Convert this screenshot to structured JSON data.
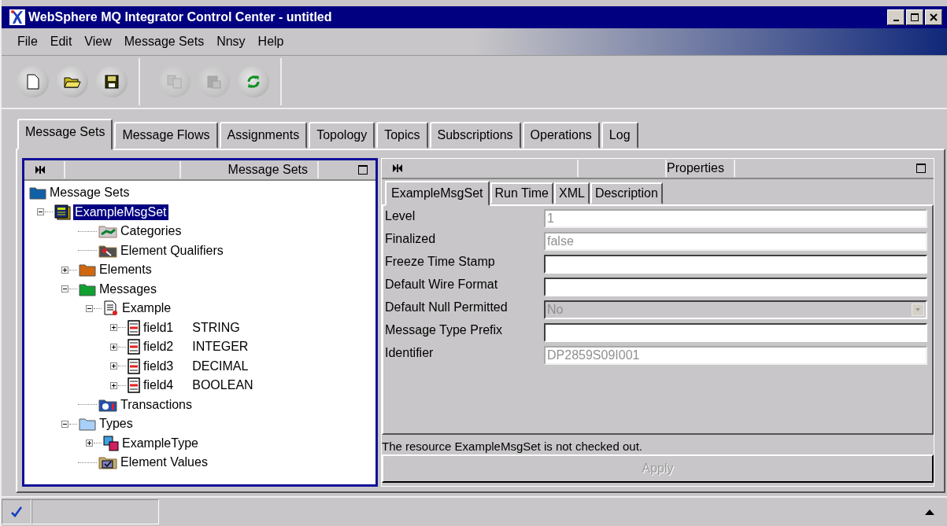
{
  "window": {
    "title": "WebSphere MQ Integrator Control Center - untitled"
  },
  "menu": [
    "File",
    "Edit",
    "View",
    "Message Sets",
    "Nnsy",
    "Help"
  ],
  "toolbar": [
    [
      {
        "kind": "new",
        "disabled": false
      },
      {
        "kind": "open",
        "disabled": false
      },
      {
        "kind": "save",
        "disabled": false
      }
    ],
    [
      {
        "kind": "copy",
        "disabled": true
      },
      {
        "kind": "paste",
        "disabled": true
      },
      {
        "kind": "refresh",
        "disabled": false
      }
    ]
  ],
  "tabs": [
    {
      "label": "Message Sets",
      "selected": true
    },
    {
      "label": "Message Flows",
      "selected": false
    },
    {
      "label": "Assignments",
      "selected": false
    },
    {
      "label": "Topology",
      "selected": false
    },
    {
      "label": "Topics",
      "selected": false
    },
    {
      "label": "Subscriptions",
      "selected": false
    },
    {
      "label": "Operations",
      "selected": false
    },
    {
      "label": "Log",
      "selected": false
    }
  ],
  "left_panel": {
    "title": "Message Sets",
    "tree": [
      {
        "label": "Message Sets",
        "kind": "folder",
        "color": "#1060a8",
        "selected": false,
        "children": [
          {
            "label": "ExampleMsgSet",
            "kind": "msgset",
            "selected": true,
            "expanded": true,
            "children": [
              {
                "label": "Categories",
                "kind": "category",
                "selected": false
              },
              {
                "label": "Element Qualifiers",
                "kind": "qualifier",
                "selected": false
              },
              {
                "label": "Elements",
                "kind": "folder",
                "color": "#d06810",
                "selected": false,
                "expanded": false
              },
              {
                "label": "Messages",
                "kind": "folder",
                "color": "#10a030",
                "selected": false,
                "expanded": true,
                "children": [
                  {
                    "label": "Example",
                    "kind": "message",
                    "selected": false,
                    "expanded": true,
                    "children": [
                      {
                        "label": "field1",
                        "type": "STRING",
                        "kind": "field",
                        "selected": false,
                        "expanded": false
                      },
                      {
                        "label": "field2",
                        "type": "INTEGER",
                        "kind": "field",
                        "selected": false,
                        "expanded": false
                      },
                      {
                        "label": "field3",
                        "type": "DECIMAL",
                        "kind": "field",
                        "selected": false,
                        "expanded": false
                      },
                      {
                        "label": "field4",
                        "type": "BOOLEAN",
                        "kind": "field",
                        "selected": false,
                        "expanded": false
                      }
                    ]
                  }
                ]
              },
              {
                "label": "Transactions",
                "kind": "transaction",
                "selected": false
              },
              {
                "label": "Types",
                "kind": "folder",
                "color": "#a8d0f8",
                "selected": false,
                "expanded": true,
                "children": [
                  {
                    "label": "ExampleType",
                    "kind": "type",
                    "selected": false,
                    "expanded": false
                  }
                ]
              },
              {
                "label": "Element Values",
                "kind": "values",
                "selected": false
              }
            ]
          }
        ]
      }
    ]
  },
  "right_panel": {
    "title": "Properties",
    "tabs": [
      {
        "label": "ExampleMsgSet",
        "selected": true
      },
      {
        "label": "Run Time",
        "selected": false
      },
      {
        "label": "XML",
        "selected": false
      },
      {
        "label": "Description",
        "selected": false
      }
    ],
    "properties": [
      {
        "label": "Level",
        "kind": "text",
        "value": "1",
        "disabled": true
      },
      {
        "label": "Finalized",
        "kind": "text",
        "value": "false",
        "disabled": true
      },
      {
        "label": "Freeze Time Stamp",
        "kind": "text",
        "disabled": false
      },
      {
        "label": "Default Wire Format",
        "kind": "text",
        "disabled": false
      },
      {
        "label": "Default Null Permitted",
        "kind": "dropdown",
        "value": "No",
        "disabled": true
      },
      {
        "label": "Message Type Prefix",
        "kind": "text",
        "disabled": false
      },
      {
        "label": "Identifier",
        "kind": "text",
        "value": "DP2859S09I001",
        "disabled": true
      }
    ],
    "message": "The resource ExampleMsgSet is not checked out.",
    "apply": {
      "label": "Apply",
      "disabled": true
    }
  }
}
